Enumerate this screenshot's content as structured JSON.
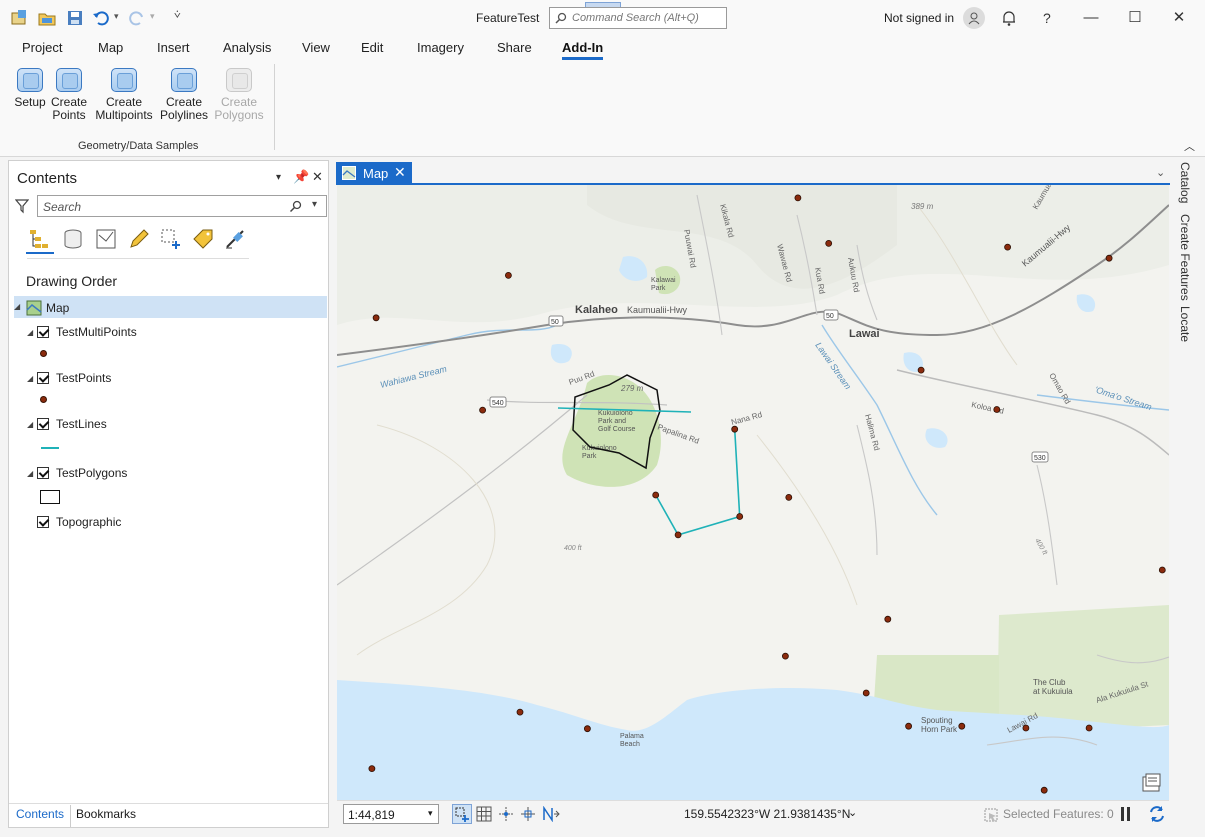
{
  "app": {
    "title": "FeatureTest",
    "command_search_placeholder": "Command Search (Alt+Q)",
    "sign_in_status": "Not signed in",
    "help_label": "?"
  },
  "menu": {
    "tabs": [
      {
        "label": "Project"
      },
      {
        "label": "Map"
      },
      {
        "label": "Insert"
      },
      {
        "label": "Analysis"
      },
      {
        "label": "View"
      },
      {
        "label": "Edit"
      },
      {
        "label": "Imagery"
      },
      {
        "label": "Share"
      },
      {
        "label": "Add-In",
        "active": true
      }
    ]
  },
  "ribbon": {
    "buttons": [
      {
        "label": "Setup",
        "enabled": true
      },
      {
        "label": "Create\nPoints",
        "enabled": true
      },
      {
        "label": "Create\nMultipoints",
        "enabled": true
      },
      {
        "label": "Create\nPolylines",
        "enabled": true
      },
      {
        "label": "Create\nPolygons",
        "enabled": false
      }
    ],
    "group_label": "Geometry/Data Samples"
  },
  "contents": {
    "title": "Contents",
    "search_placeholder": "Search",
    "section_title": "Drawing Order",
    "map_item": "Map",
    "layers": [
      {
        "name": "TestMultiPoints",
        "checked": true,
        "symbol": "point"
      },
      {
        "name": "TestPoints",
        "checked": true,
        "symbol": "point"
      },
      {
        "name": "TestLines",
        "checked": true,
        "symbol": "line"
      },
      {
        "name": "TestPolygons",
        "checked": true,
        "symbol": "polygon"
      },
      {
        "name": "Topographic",
        "checked": true,
        "symbol": "none"
      }
    ],
    "bottom_tabs": [
      "Contents",
      "Bookmarks"
    ]
  },
  "map_view": {
    "tab_label": "Map",
    "close_glyph": "✕",
    "labels": {
      "kalaheo": "Kalaheo",
      "kaumualii_hwy_w": "Kaumualii-Hwy",
      "kaumualii_hwy_e": "Kaumualii-Hwy",
      "lawai": "Lawai",
      "route_50_a": "50",
      "route_50_b": "50",
      "route_540": "540",
      "route_530": "530",
      "wahiawa_stream": "Wahiawa Stream",
      "lawai_stream": "Lawai Stream",
      "omao_stream": "'Oma'o Stream",
      "kalawai_park": "Kalawai\nPark",
      "kukuiolono": "Kukuiolono\nPark and\nGolf Course",
      "kukuiolono_park": "Kukuiolono\nPark",
      "puu_rd": "Puu Rd",
      "papalina_rd": "Papalina Rd",
      "nana_rd": "Nana Rd",
      "koloa_rd": "Koloa Rd",
      "omao_rd": "Omao Rd",
      "halima_rd": "Halima Rd",
      "ala_kukuiula": "Ala Kukuiula St",
      "lawai_rd": "Lawai Rd",
      "club_kukuiula": "The Club\nat Kukuiula",
      "spouting_horn": "Spouting\nHorn Park",
      "palama_beach": "Palama\nBeach",
      "elev_279": "279 m",
      "elev_389": "389 m",
      "elev_400": "400 ft",
      "elev_1": "400 ft",
      "kikala_rd": "Kikala Rd",
      "puuwai_rd": "Puuwai Rd",
      "wawae_rd": "Wawae Rd",
      "kuai_rd": "Kua Rd",
      "aukuu_rd": "Aukuu Rd",
      "kaumualii_road_n": "Kaumualii Hwy"
    },
    "points": [
      {
        "lon": 0.554,
        "lat": 0.021
      },
      {
        "lon": 0.591,
        "lat": 0.095
      },
      {
        "lon": 0.806,
        "lat": 0.101
      },
      {
        "lon": 0.928,
        "lat": 0.119
      },
      {
        "lon": 0.206,
        "lat": 0.147
      },
      {
        "lon": 0.047,
        "lat": 0.216
      },
      {
        "lon": 0.702,
        "lat": 0.301
      },
      {
        "lon": 0.175,
        "lat": 0.366
      },
      {
        "lon": 0.793,
        "lat": 0.365
      },
      {
        "lon": 0.543,
        "lat": 0.508
      },
      {
        "lon": 0.992,
        "lat": 0.626
      },
      {
        "lon": 0.662,
        "lat": 0.706
      },
      {
        "lon": 0.539,
        "lat": 0.766
      },
      {
        "lon": 0.636,
        "lat": 0.826
      },
      {
        "lon": 0.22,
        "lat": 0.857
      },
      {
        "lon": 0.301,
        "lat": 0.884
      },
      {
        "lon": 0.687,
        "lat": 0.88
      },
      {
        "lon": 0.751,
        "lat": 0.88
      },
      {
        "lon": 0.828,
        "lat": 0.883
      },
      {
        "lon": 0.904,
        "lat": 0.883
      },
      {
        "lon": 0.042,
        "lat": 0.949
      },
      {
        "lon": 0.85,
        "lat": 0.984
      }
    ],
    "polyline_vertices": [
      {
        "lon": 0.478,
        "lat": 0.397
      },
      {
        "lon": 0.484,
        "lat": 0.539
      },
      {
        "lon": 0.41,
        "lat": 0.569
      },
      {
        "lon": 0.383,
        "lat": 0.504
      }
    ],
    "multipoint_sample": {
      "lon": 0.178,
      "lat": 0.366
    }
  },
  "status": {
    "scale": "1:44,819",
    "coordinates": "159.5542323°W 21.9381435°N",
    "selected_features": "Selected Features: 0"
  },
  "dock": {
    "tabs": [
      "Catalog",
      "Create Features",
      "Locate"
    ]
  },
  "colors": {
    "accent": "#1b6ac9",
    "point_fill": "#8b2b0d",
    "line_color": "#1fb2b8",
    "water": "#cfe8fb",
    "park": "#cfe3b6"
  }
}
